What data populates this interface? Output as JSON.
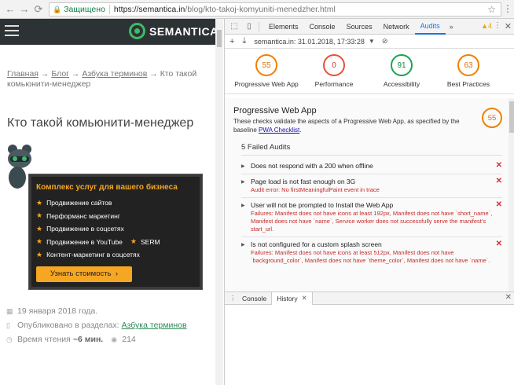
{
  "browser": {
    "secure_label": "Защищено",
    "url_host": "https://semantica.in",
    "url_path": "/blog/kto-takoj-komyuniti-menedzher.html"
  },
  "site": {
    "logo_text": "SEMANTICA",
    "breadcrumb": {
      "home": "Главная",
      "blog": "Блог",
      "glossary": "Азбука терминов",
      "current": "Кто такой комьюнити-менеджер",
      "separator": "→"
    },
    "article_title": "Кто такой комьюнити-менеджер",
    "promo": {
      "title": "Комплекс услуг для вашего бизнеса",
      "items": [
        "Продвижение сайтов",
        "Перформанс маркетинг",
        "Продвижение в соцсетях",
        "Продвижение в YouTube",
        "Контент-маркетинг в соцсетях"
      ],
      "extra_item": "SERM",
      "button": "Узнать стоимость"
    },
    "meta": {
      "date": "19 января 2018 года.",
      "published_prefix": "Опубликовано в разделах:",
      "published_link": "Азбука терминов",
      "read_time_prefix": "Время чтения",
      "read_time": "~6 мин.",
      "views": "214"
    }
  },
  "devtools": {
    "tabs": [
      "Elements",
      "Console",
      "Sources",
      "Network",
      "Audits"
    ],
    "active_tab": "Audits",
    "more": "»",
    "warnings": "4",
    "run_label": "semantica.in: 31.01.2018, 17:33:28",
    "scores": [
      {
        "label": "Progressive Web App",
        "value": "55"
      },
      {
        "label": "Performance",
        "value": "0"
      },
      {
        "label": "Accessibility",
        "value": "91"
      },
      {
        "label": "Best Practices",
        "value": "63"
      }
    ],
    "category": {
      "title": "Progressive Web App",
      "description": "These checks validate the aspects of a Progressive Web App, as specified by the baseline",
      "link": "PWA Checklist",
      "score": "55",
      "failed_title": "5 Failed Audits"
    },
    "audits": [
      {
        "title": "Does not respond with a 200 when offline",
        "detail": ""
      },
      {
        "title": "Page load is not fast enough on 3G",
        "detail": "Audit error: No firstMeaningfulPaint event in trace"
      },
      {
        "title": "User will not be prompted to Install the Web App",
        "detail": "Failures: Manifest does not have icons at least 192px, Manifest does not have `short_name`, Manifest does not have `name`, Service worker does not successfully serve the manifest's start_url."
      },
      {
        "title": "Is not configured for a custom splash screen",
        "detail": "Failures: Manifest does not have icons at least 512px, Manifest does not have `background_color`, Manifest does not have `theme_color`, Manifest does not have `name`."
      }
    ],
    "drawer_tabs": [
      "Console",
      "History"
    ],
    "drawer_active": "History"
  }
}
